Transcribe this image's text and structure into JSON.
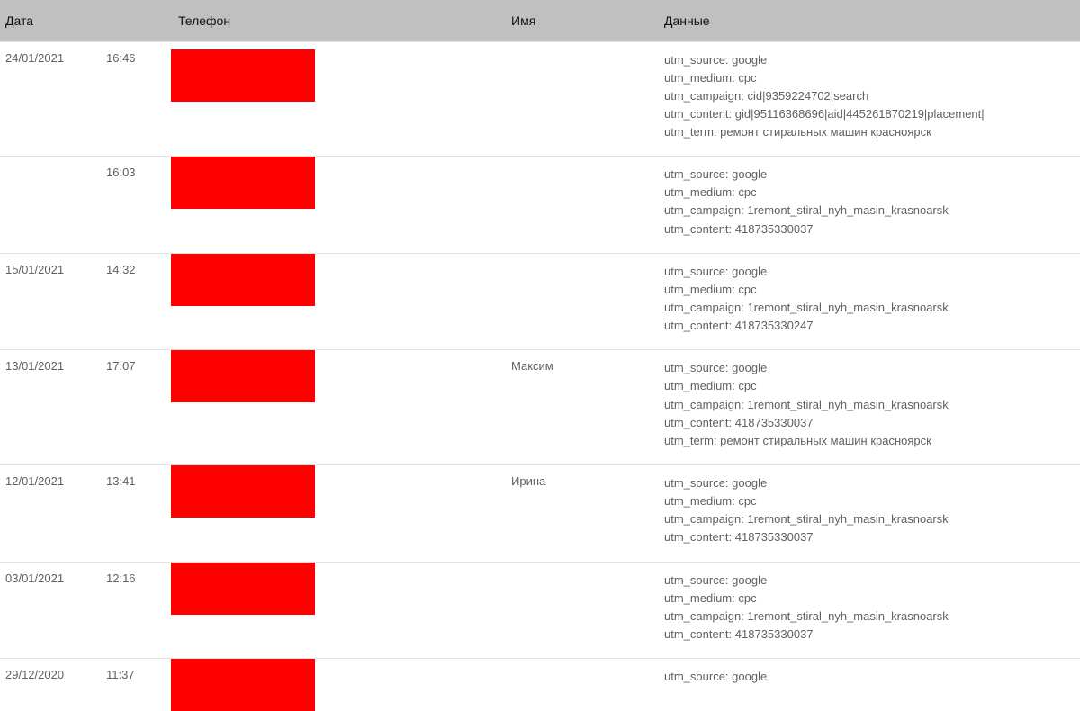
{
  "headers": {
    "date": "Дата",
    "phone": "Телефон",
    "name": "Имя",
    "data": "Данные"
  },
  "rows": [
    {
      "date": "24/01/2021",
      "time": "16:46",
      "name": "",
      "data": [
        "utm_source: google",
        "utm_medium: cpc",
        "utm_campaign: cid|9359224702|search",
        "utm_content: gid|95116368696|aid|445261870219|placement|",
        "utm_term: ремонт стиральных машин красноярск"
      ]
    },
    {
      "date": "",
      "time": "16:03",
      "name": "",
      "data": [
        "utm_source: google",
        "utm_medium: cpc",
        "utm_campaign: 1remont_stiral_nyh_masin_krasnoarsk",
        "utm_content: 418735330037"
      ]
    },
    {
      "date": "15/01/2021",
      "time": "14:32",
      "name": "",
      "data": [
        "utm_source: google",
        "utm_medium: cpc",
        "utm_campaign: 1remont_stiral_nyh_masin_krasnoarsk",
        "utm_content: 418735330247"
      ]
    },
    {
      "date": "13/01/2021",
      "time": "17:07",
      "name": "Максим",
      "data": [
        "utm_source: google",
        "utm_medium: cpc",
        "utm_campaign: 1remont_stiral_nyh_masin_krasnoarsk",
        "utm_content: 418735330037",
        "utm_term: ремонт стиральных машин красноярск"
      ]
    },
    {
      "date": "12/01/2021",
      "time": "13:41",
      "name": "Ирина",
      "data": [
        "utm_source: google",
        "utm_medium: cpc",
        "utm_campaign: 1remont_stiral_nyh_masin_krasnoarsk",
        "utm_content: 418735330037"
      ]
    },
    {
      "date": "03/01/2021",
      "time": "12:16",
      "name": "",
      "data": [
        "utm_source: google",
        "utm_medium: cpc",
        "utm_campaign: 1remont_stiral_nyh_masin_krasnoarsk",
        "utm_content: 418735330037"
      ]
    },
    {
      "date": "29/12/2020",
      "time": "11:37",
      "name": "",
      "data": [
        "utm_source: google"
      ]
    }
  ]
}
